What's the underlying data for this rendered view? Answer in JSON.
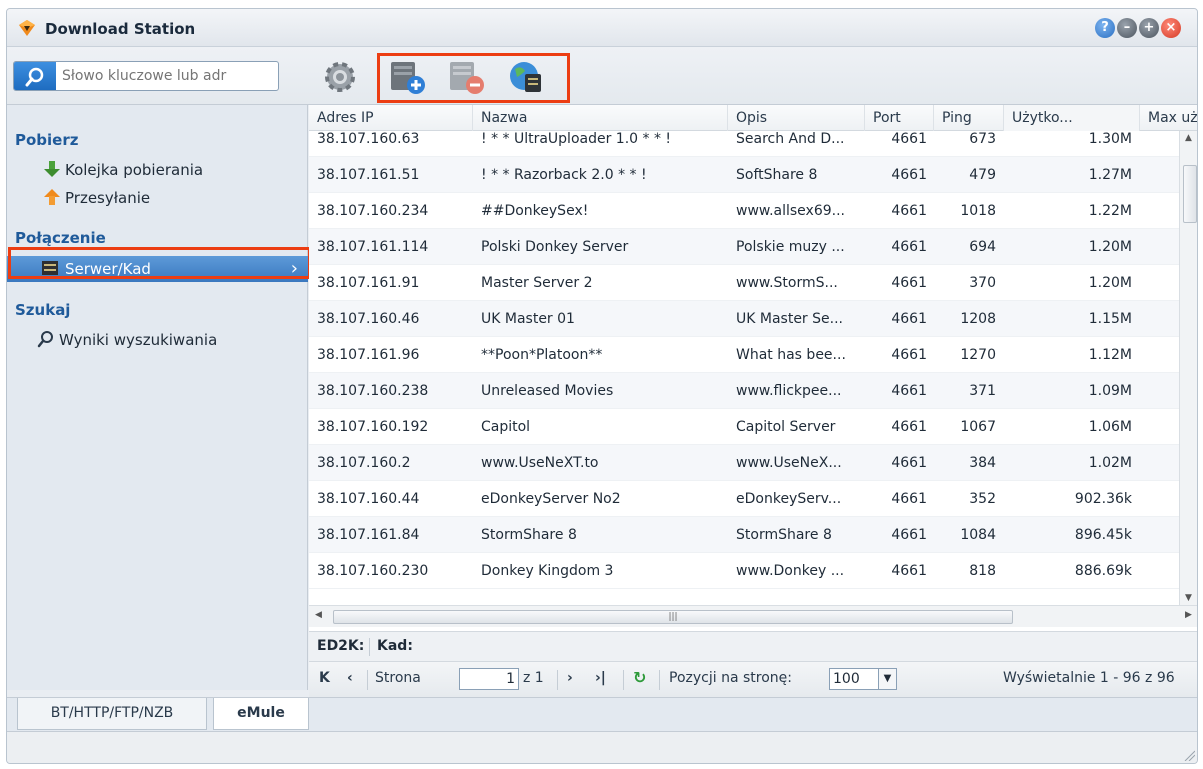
{
  "window": {
    "title": "Download Station"
  },
  "search": {
    "placeholder": "Słowo kluczowe lub adr"
  },
  "sidebar": {
    "sections": [
      {
        "title": "Pobierz"
      },
      {
        "title": "Połączenie"
      },
      {
        "title": "Szukaj"
      }
    ],
    "items": [
      {
        "label": "Kolejka pobierania"
      },
      {
        "label": "Przesyłanie"
      },
      {
        "label": "Serwer/Kad",
        "selected": true
      },
      {
        "label": "Wyniki wyszukiwania"
      }
    ]
  },
  "grid": {
    "columns": [
      "Adres IP",
      "Nazwa",
      "Opis",
      "Port",
      "Ping",
      "Użytko...",
      "Max uż"
    ],
    "rows": [
      [
        "38.107.160.63",
        "! * * UltraUploader 1.0 * * !",
        "Search And D...",
        "4661",
        "673",
        "1.30M"
      ],
      [
        "38.107.161.51",
        "! * * Razorback 2.0 * * !",
        "SoftShare 8",
        "4661",
        "479",
        "1.27M"
      ],
      [
        "38.107.160.234",
        "##DonkeySex!",
        "www.allsex69...",
        "4661",
        "1018",
        "1.22M"
      ],
      [
        "38.107.161.114",
        "Polski Donkey Server",
        "Polskie muzy ...",
        "4661",
        "694",
        "1.20M"
      ],
      [
        "38.107.161.91",
        "Master Server 2",
        "www.StormS...",
        "4661",
        "370",
        "1.20M"
      ],
      [
        "38.107.160.46",
        "UK Master 01",
        "UK Master Se...",
        "4661",
        "1208",
        "1.15M"
      ],
      [
        "38.107.161.96",
        "**Poon*Platoon**",
        "What has bee...",
        "4661",
        "1270",
        "1.12M"
      ],
      [
        "38.107.160.238",
        "Unreleased Movies",
        "www.flickpee...",
        "4661",
        "371",
        "1.09M"
      ],
      [
        "38.107.160.192",
        "Capitol",
        "Capitol Server",
        "4661",
        "1067",
        "1.06M"
      ],
      [
        "38.107.160.2",
        "www.UseNeXT.to",
        "www.UseNeX...",
        "4661",
        "384",
        "1.02M"
      ],
      [
        "38.107.160.44",
        "eDonkeyServer No2",
        "eDonkeyServ...",
        "4661",
        "352",
        "902.36k"
      ],
      [
        "38.107.161.84",
        "StormShare 8",
        "StormShare 8",
        "4661",
        "1084",
        "896.45k"
      ],
      [
        "38.107.160.230",
        "Donkey Kingdom 3",
        "www.Donkey ...",
        "4661",
        "818",
        "886.69k"
      ]
    ]
  },
  "status": {
    "ed2k_label": "ED2K:",
    "kad_label": "Kad:"
  },
  "paging": {
    "page_label": "Strona",
    "page_value": "1",
    "of_label": "z 1",
    "per_page_label": "Pozycji na stronę:",
    "per_page_value": "100",
    "display_info": "Wyświetalnie 1 - 96 z 96"
  },
  "tabs": [
    {
      "label": "BT/HTTP/FTP/NZB"
    },
    {
      "label": "eMule",
      "active": true
    }
  ]
}
